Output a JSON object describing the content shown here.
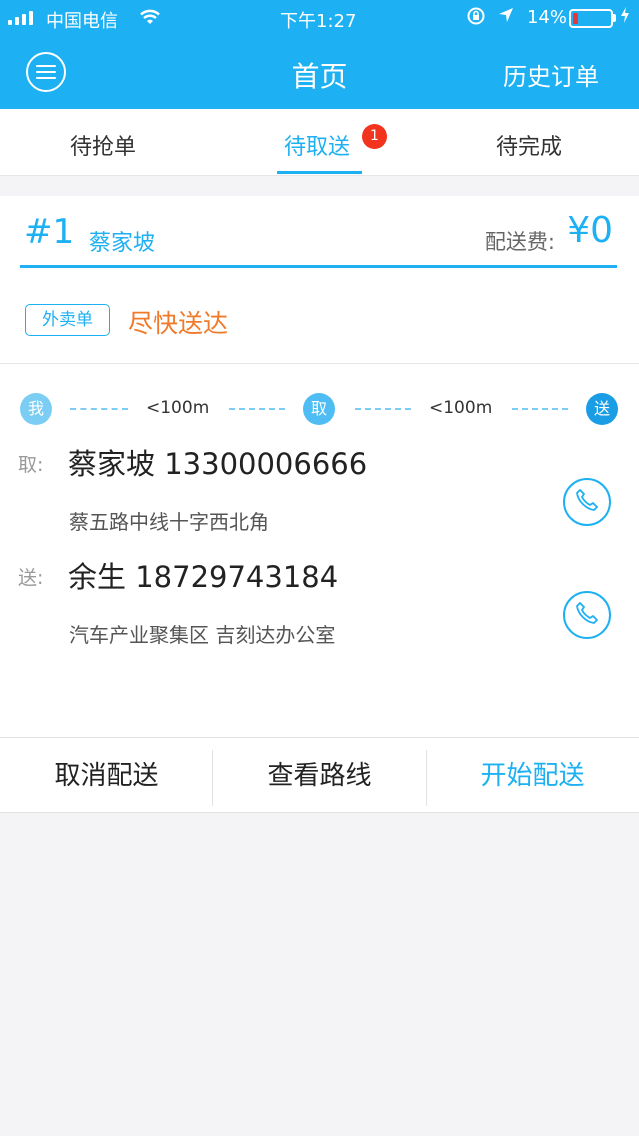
{
  "status_bar": {
    "carrier": "中国电信",
    "time": "下午1:27",
    "battery": "14%"
  },
  "nav": {
    "title": "首页",
    "history": "历史订单"
  },
  "tabs": [
    {
      "label": "待抢单"
    },
    {
      "label": "待取送",
      "badge": "1"
    },
    {
      "label": "待完成"
    }
  ],
  "order": {
    "number": "#1",
    "name": "蔡家坡",
    "fee_label": "配送费:",
    "fee": "¥0",
    "type_tag": "外卖单",
    "urgency": "尽快送达"
  },
  "route": {
    "me": "我",
    "pickup": "取",
    "dropoff": "送",
    "dist1": "<100m",
    "dist2": "<100m"
  },
  "pickup": {
    "label": "取:",
    "contact": "蔡家坡  13300006666",
    "address": "蔡五路中线十字西北角"
  },
  "dropoff": {
    "label": "送:",
    "contact": "余生  18729743184",
    "address": "汽车产业聚集区 吉刻达办公室"
  },
  "actions": {
    "cancel": "取消配送",
    "route": "查看路线",
    "start": "开始配送"
  },
  "colors": {
    "accent": "#1db0f2",
    "urgent": "#f07a2a",
    "badge": "#f2331d"
  }
}
